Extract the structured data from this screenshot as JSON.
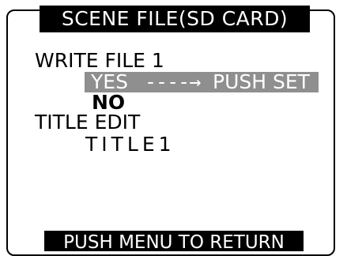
{
  "screen": {
    "title": "SCENE FILE(SD CARD)"
  },
  "menu": {
    "write_file_label": "WRITE FILE 1",
    "selected_option": {
      "yes": "YES",
      "arrow": "----→",
      "instruction": "PUSH SET"
    },
    "no_option": "NO",
    "title_edit_label": "TITLE EDIT",
    "title_value": "TITLE1"
  },
  "footer": {
    "instruction": "PUSH MENU TO RETURN"
  },
  "colors": {
    "background": "#ffffff",
    "text": "#000000",
    "bar_background": "#000000",
    "selected_background": "#8f8f8f",
    "selected_text": "#ffffff"
  }
}
